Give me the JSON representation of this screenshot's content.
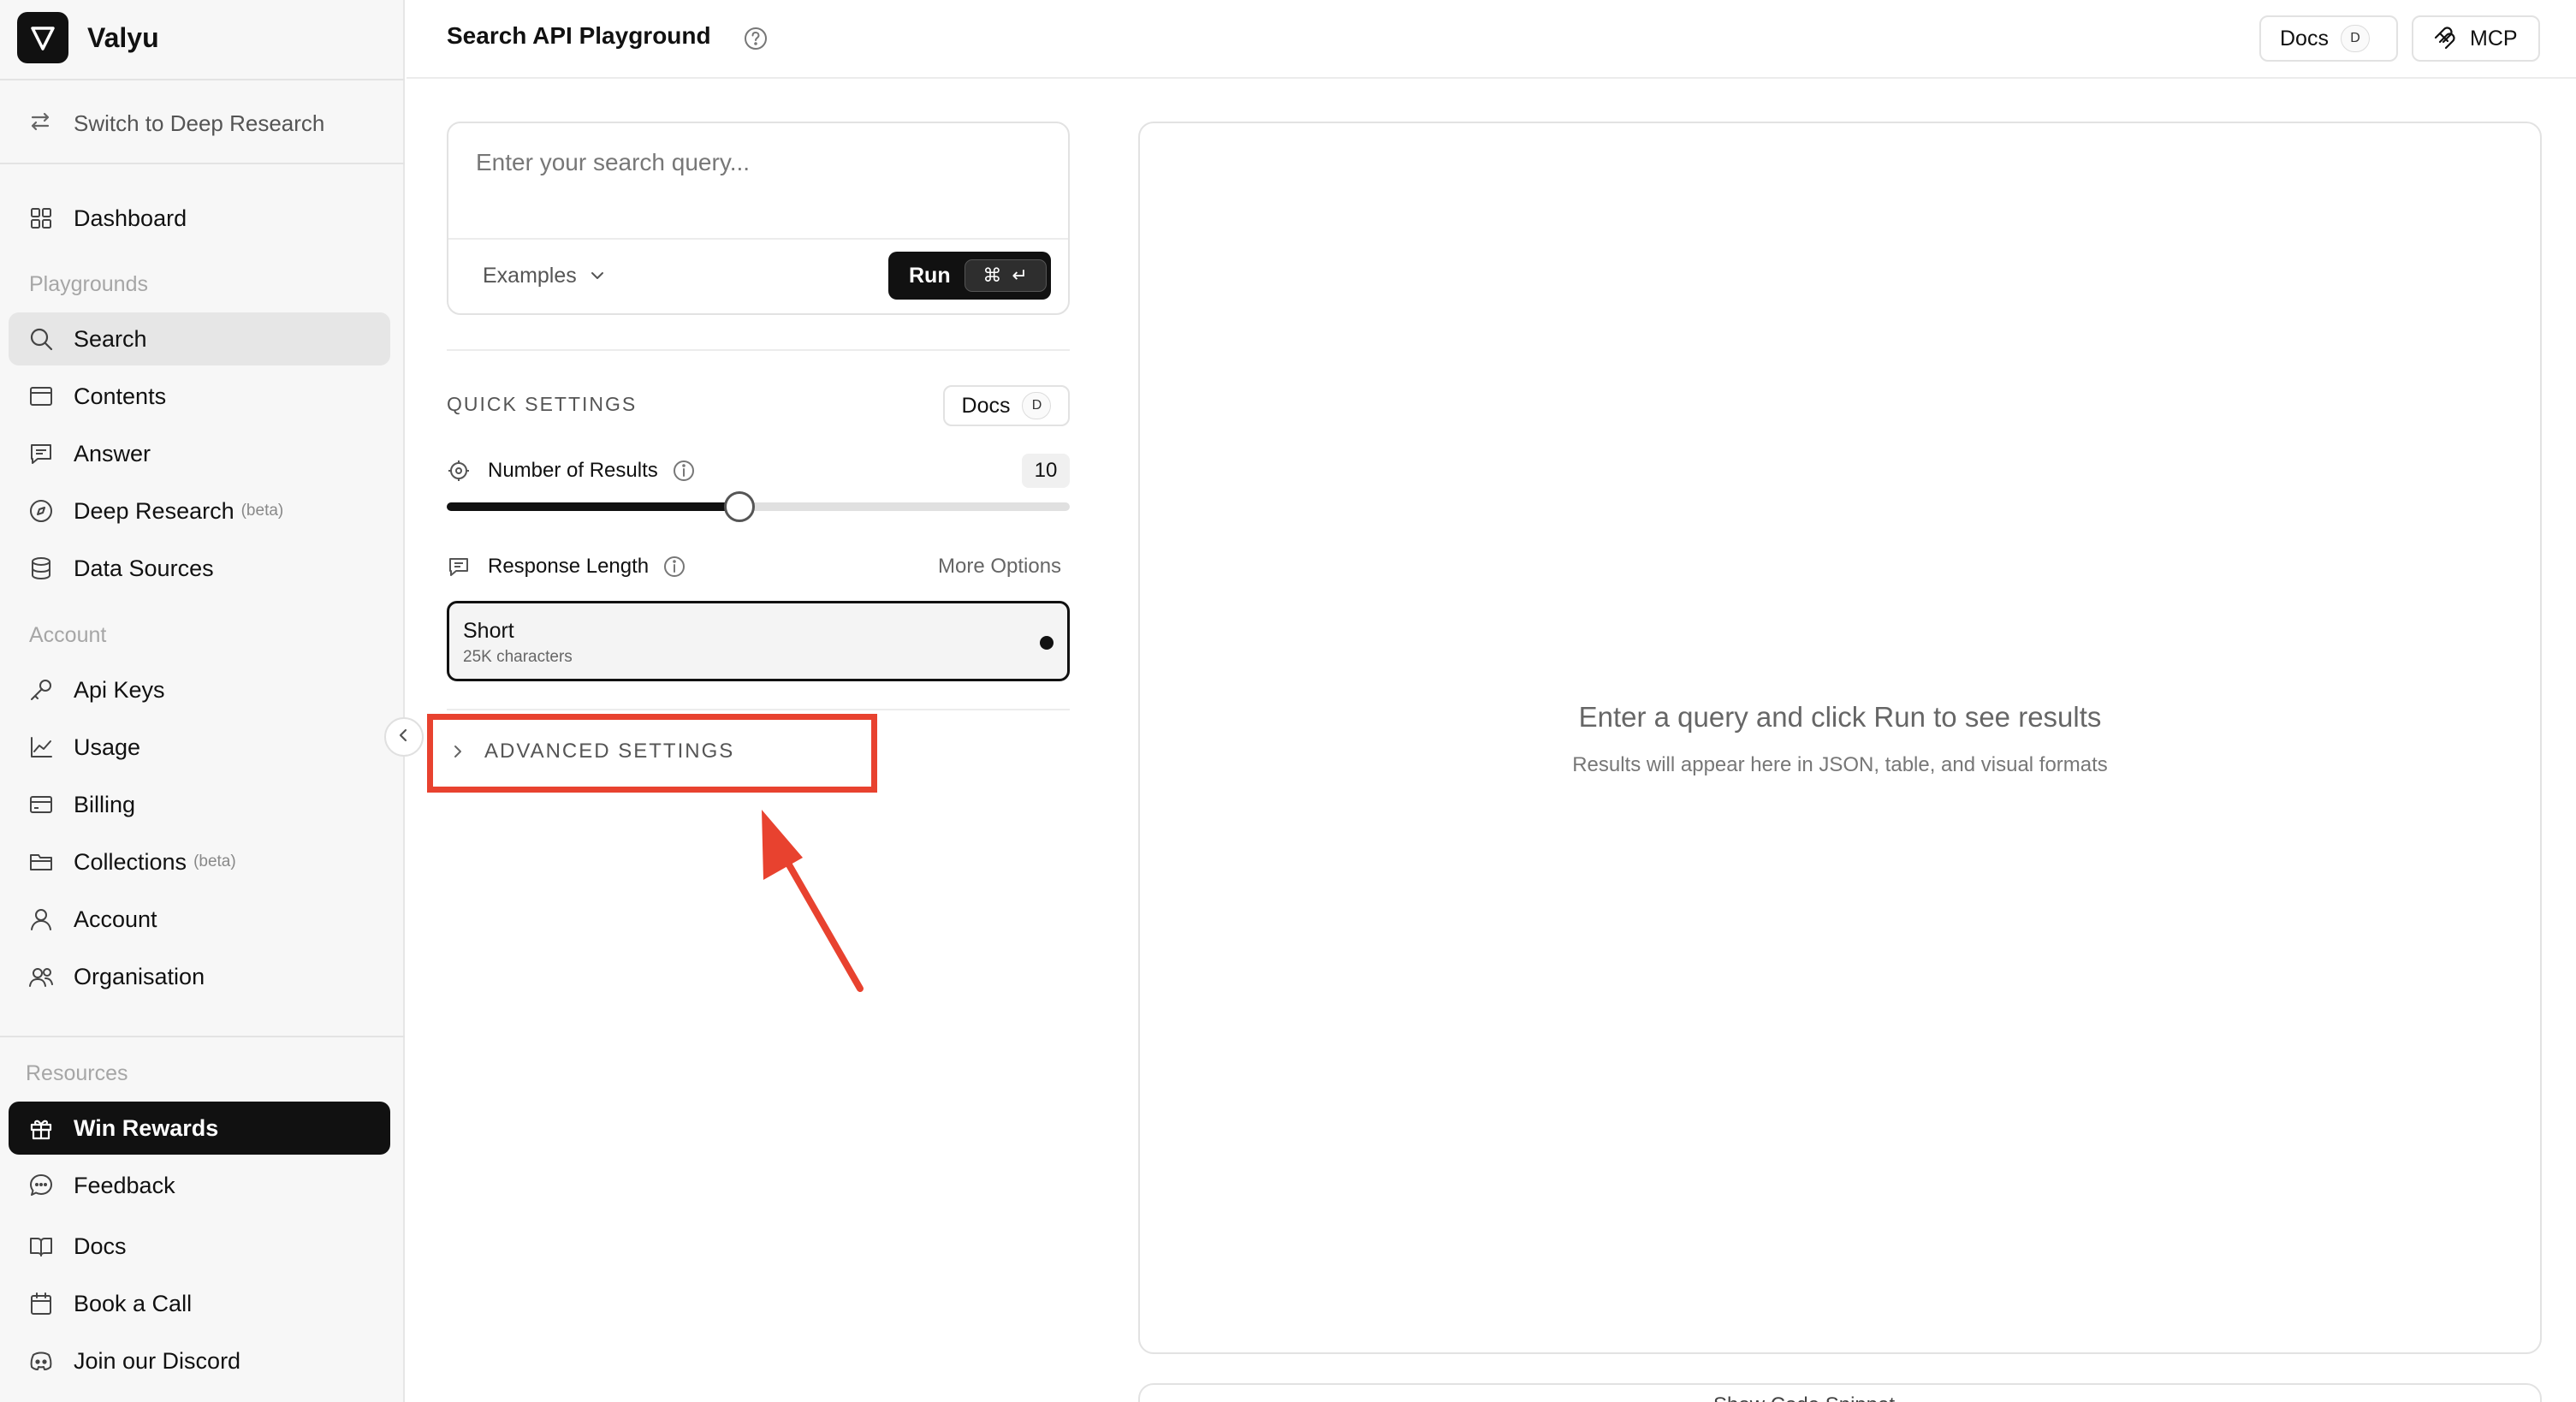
{
  "brand": {
    "name": "Valyu"
  },
  "sidebar": {
    "switch_label": "Switch to Deep Research",
    "dashboard": "Dashboard",
    "playgrounds_label": "Playgrounds",
    "playgrounds": [
      {
        "label": "Search",
        "icon": "search-icon",
        "active": true
      },
      {
        "label": "Contents",
        "icon": "browser-window-icon"
      },
      {
        "label": "Answer",
        "icon": "message-square-icon"
      },
      {
        "label": "Deep Research",
        "badge": "(beta)",
        "icon": "compass-icon"
      },
      {
        "label": "Data Sources",
        "icon": "database-icon"
      }
    ],
    "account_label": "Account",
    "account": [
      {
        "label": "Api Keys",
        "icon": "key-icon"
      },
      {
        "label": "Usage",
        "icon": "line-chart-icon"
      },
      {
        "label": "Billing",
        "icon": "credit-card-icon"
      },
      {
        "label": "Collections",
        "badge": "(beta)",
        "icon": "folder-icon"
      },
      {
        "label": "Account",
        "icon": "user-icon"
      },
      {
        "label": "Organisation",
        "icon": "users-icon"
      }
    ],
    "resources_label": "Resources",
    "resources": [
      {
        "label": "Win Rewards",
        "icon": "gift-icon",
        "highlight": true
      },
      {
        "label": "Feedback",
        "icon": "chat-bubble-icon"
      },
      {
        "label": "Docs",
        "icon": "book-open-icon"
      },
      {
        "label": "Book a Call",
        "icon": "calendar-icon"
      },
      {
        "label": "Join our Discord",
        "icon": "discord-icon"
      }
    ]
  },
  "header": {
    "title": "Search API Playground",
    "docs_label": "Docs",
    "docs_shortcut": "D",
    "mcp_label": "MCP"
  },
  "query": {
    "placeholder": "Enter your search query...",
    "value": "",
    "examples_label": "Examples",
    "run_label": "Run",
    "run_shortcut_cmd": "⌘",
    "run_shortcut_enter": "↵"
  },
  "quick_settings": {
    "title": "QUICK SETTINGS",
    "docs_label": "Docs",
    "docs_shortcut": "D",
    "num_results_label": "Number of Results",
    "num_results_value": "10",
    "num_results_fraction": 0.47,
    "response_length_label": "Response Length",
    "more_options": "More Options",
    "length_option_title": "Short",
    "length_option_sub": "25K characters"
  },
  "advanced": {
    "label": "ADVANCED SETTINGS"
  },
  "results": {
    "empty_title": "Enter a query and click Run to see results",
    "empty_sub": "Results will appear here in JSON, table, and visual formats",
    "code_snippet_label": "Show Code Snippet"
  },
  "colors": {
    "accent_dark": "#111111",
    "annotation_red": "#e8422f",
    "sidebar_bg": "#f7f7f7"
  }
}
